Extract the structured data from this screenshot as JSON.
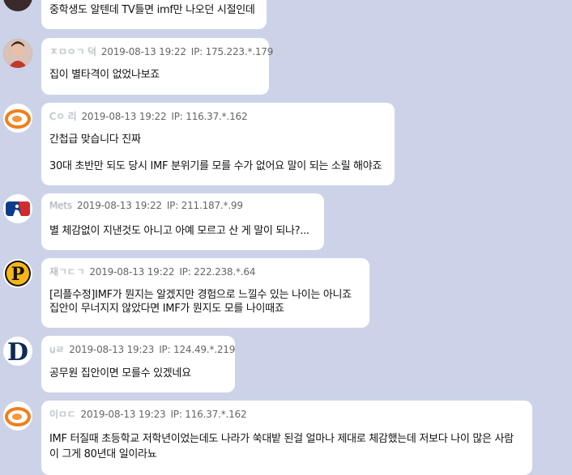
{
  "messages": [
    {
      "avatar": "partial-avatar",
      "lines": [
        "중학생도 알텐데 TV틀면 imf만 나오던 시절인데"
      ]
    },
    {
      "avatar": "person-photo-avatar",
      "nick": "ㅈㅁㅇㄱ 덕",
      "date": "2019-08-13 19:22",
      "ip": "IP: 175.223.*.179",
      "lines": [
        "집이 별타격이 없었나보죠"
      ]
    },
    {
      "avatar": "orange-swirl-avatar",
      "nick": "Cㅇ 리",
      "date": "2019-08-13 19:22",
      "ip": "IP: 116.37.*.162",
      "lines": [
        "간첩급 맞습니다 진짜",
        "30대 초반만 되도 당시 IMF 분위기를 모를 수가 없어요 말이 되는 소릴 해야죠"
      ]
    },
    {
      "avatar": "mlb-logo-avatar",
      "nick": "Mets",
      "date": "2019-08-13 19:22",
      "ip": "IP: 211.187.*.99",
      "lines": [
        "별 체감없이 지낸것도 아니고 아예 모르고 산 게 말이 되나?..."
      ]
    },
    {
      "avatar": "pirates-p-avatar",
      "nick": "재ㄱㄷㄱ",
      "date": "2019-08-13 19:22",
      "ip": "IP: 222.238.*.64",
      "lines": [
        "[리플수정]IMF가 뭔지는 알겠지만 경험으로 느낄수 있는 나이는 아니죠",
        "집안이 무너지지 않았다면 IMF가 뭔지도 모를 나이때죠"
      ]
    },
    {
      "avatar": "tigers-d-avatar",
      "nick": "uㄹ",
      "date": "2019-08-13 19:23",
      "ip": "IP: 124.49.*.219",
      "lines": [
        "공무원 집안이면 모를수 있겠네요"
      ]
    },
    {
      "avatar": "orange-swirl-avatar",
      "nick": "이ㅁㄷ",
      "date": "2019-08-13 19:23",
      "ip": "IP: 116.37.*.162",
      "lines": [
        "IMF 터질때 초등학교 저학년이었는데도 나라가 쑥대밭 된걸 얼마나 제대로 체감했는데 저보다 나이 많은 사람이 그게 80년대 일이라뇨"
      ]
    }
  ]
}
